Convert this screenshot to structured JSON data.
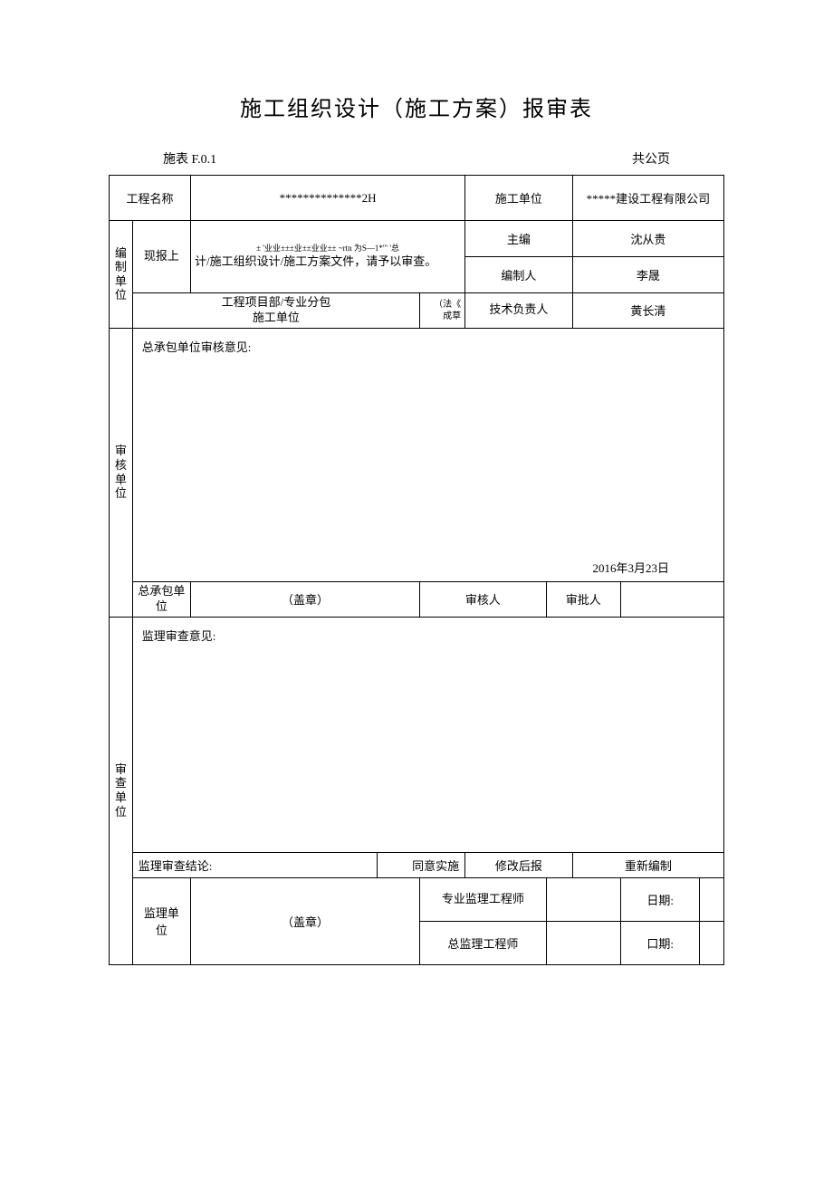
{
  "title": "施工组织设计（施工方案）报审表",
  "header": {
    "left": "施表 F.0.1",
    "right": "共公页"
  },
  "row1": {
    "label1": "工程名称",
    "value1": "**************2H",
    "label2": "施工单位",
    "value2": "*****建设工程有限公司"
  },
  "section_compile": {
    "side_label": "编制单位",
    "report_prefix": "现报上",
    "report_line1": "± '业业±±±业±±业业±± ~rtn 为S—1*'\" '总",
    "report_line2": "计/施工组织设计/施工方案文件，请予以审查。",
    "chief_editor_label": "主编",
    "chief_editor_value": "沈从贵",
    "compiler_label": "编制人",
    "compiler_value": "李晟",
    "org_label1": "工程项目部/专业分包",
    "org_label2": "施工单位",
    "org_note1": "（法《",
    "org_note2": "成草",
    "tech_lead_label": "技术负责人",
    "tech_lead_value": "黄长清"
  },
  "section_audit": {
    "side_label": "审核单位",
    "opinion_label": "总承包单位审核意见:",
    "date": "2016年3月23日",
    "contractor_label": "总承包单位",
    "seal": "（盖章）",
    "auditor_label": "审核人",
    "approver_label": "审批人"
  },
  "section_review": {
    "side_label": "审查单位",
    "opinion_label": "监理审查意见:",
    "conclusion_label": "监理审查结论:",
    "option1": "同意实施",
    "option2": "修改后报",
    "option3": "重新编制",
    "supervisor_unit_label": "监理单位",
    "seal": "（盖章）",
    "pro_engineer_label": "专业监理工程师",
    "date_label1": "日期:",
    "chief_engineer_label": "总监理工程师",
    "date_label2": "口期:"
  }
}
